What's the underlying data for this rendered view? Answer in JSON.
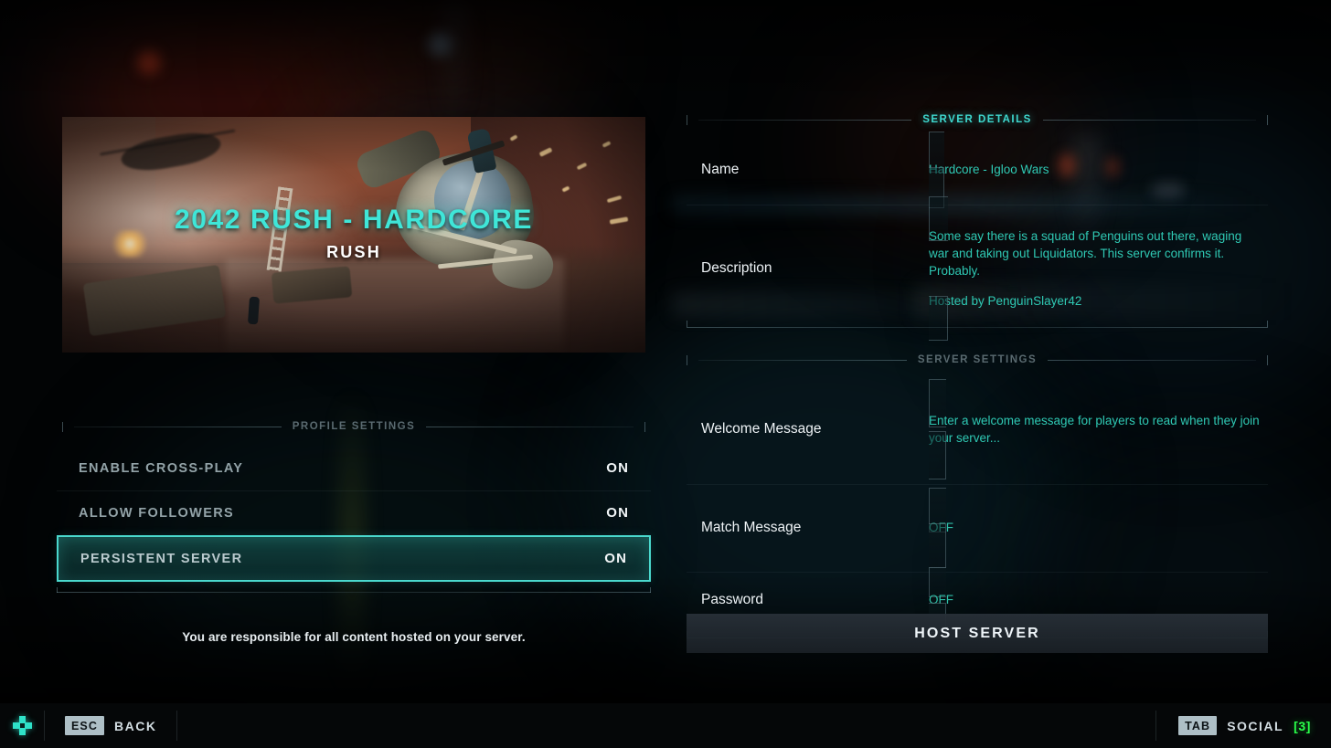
{
  "banner": {
    "title": "2042 RUSH - HARDCORE",
    "subtitle": "RUSH"
  },
  "profile_settings": {
    "section_title": "PROFILE SETTINGS",
    "rows": [
      {
        "label": "ENABLE CROSS-PLAY",
        "value": "ON",
        "selected": false
      },
      {
        "label": "ALLOW FOLLOWERS",
        "value": "ON",
        "selected": false
      },
      {
        "label": "PERSISTENT SERVER",
        "value": "ON",
        "selected": true
      }
    ],
    "disclaimer": "You are responsible for all content hosted on your server."
  },
  "server_details": {
    "section_title": "SERVER DETAILS",
    "name_label": "Name",
    "name_value": "Hardcore - Igloo Wars",
    "description_label": "Description",
    "description_value": "Some say there is a squad of Penguins out there, waging war and taking out Liquidators. This server confirms it. Probably.",
    "description_host": "Hosted by PenguinSlayer42"
  },
  "server_settings": {
    "section_title": "SERVER SETTINGS",
    "welcome_label": "Welcome Message",
    "welcome_placeholder": "Enter a welcome message for players to read when they join your server...",
    "match_label": "Match Message",
    "match_value": "OFF",
    "password_label": "Password",
    "password_value": "OFF"
  },
  "actions": {
    "host_server": "HOST SERVER"
  },
  "bottom_bar": {
    "back_key": "ESC",
    "back_label": "BACK",
    "social_key": "TAB",
    "social_label": "SOCIAL",
    "social_count": "[3]",
    "dpad_icon": "dpad-icon"
  },
  "colors": {
    "accent_teal": "#3fd8cf",
    "accent_title": "#3fe6d8",
    "input_text": "#2fc9b4",
    "selected_border": "#4ad8cd",
    "social_count": "#2aff4a",
    "label_white": "#eef3f6",
    "section_dim": "#5a6a70"
  }
}
